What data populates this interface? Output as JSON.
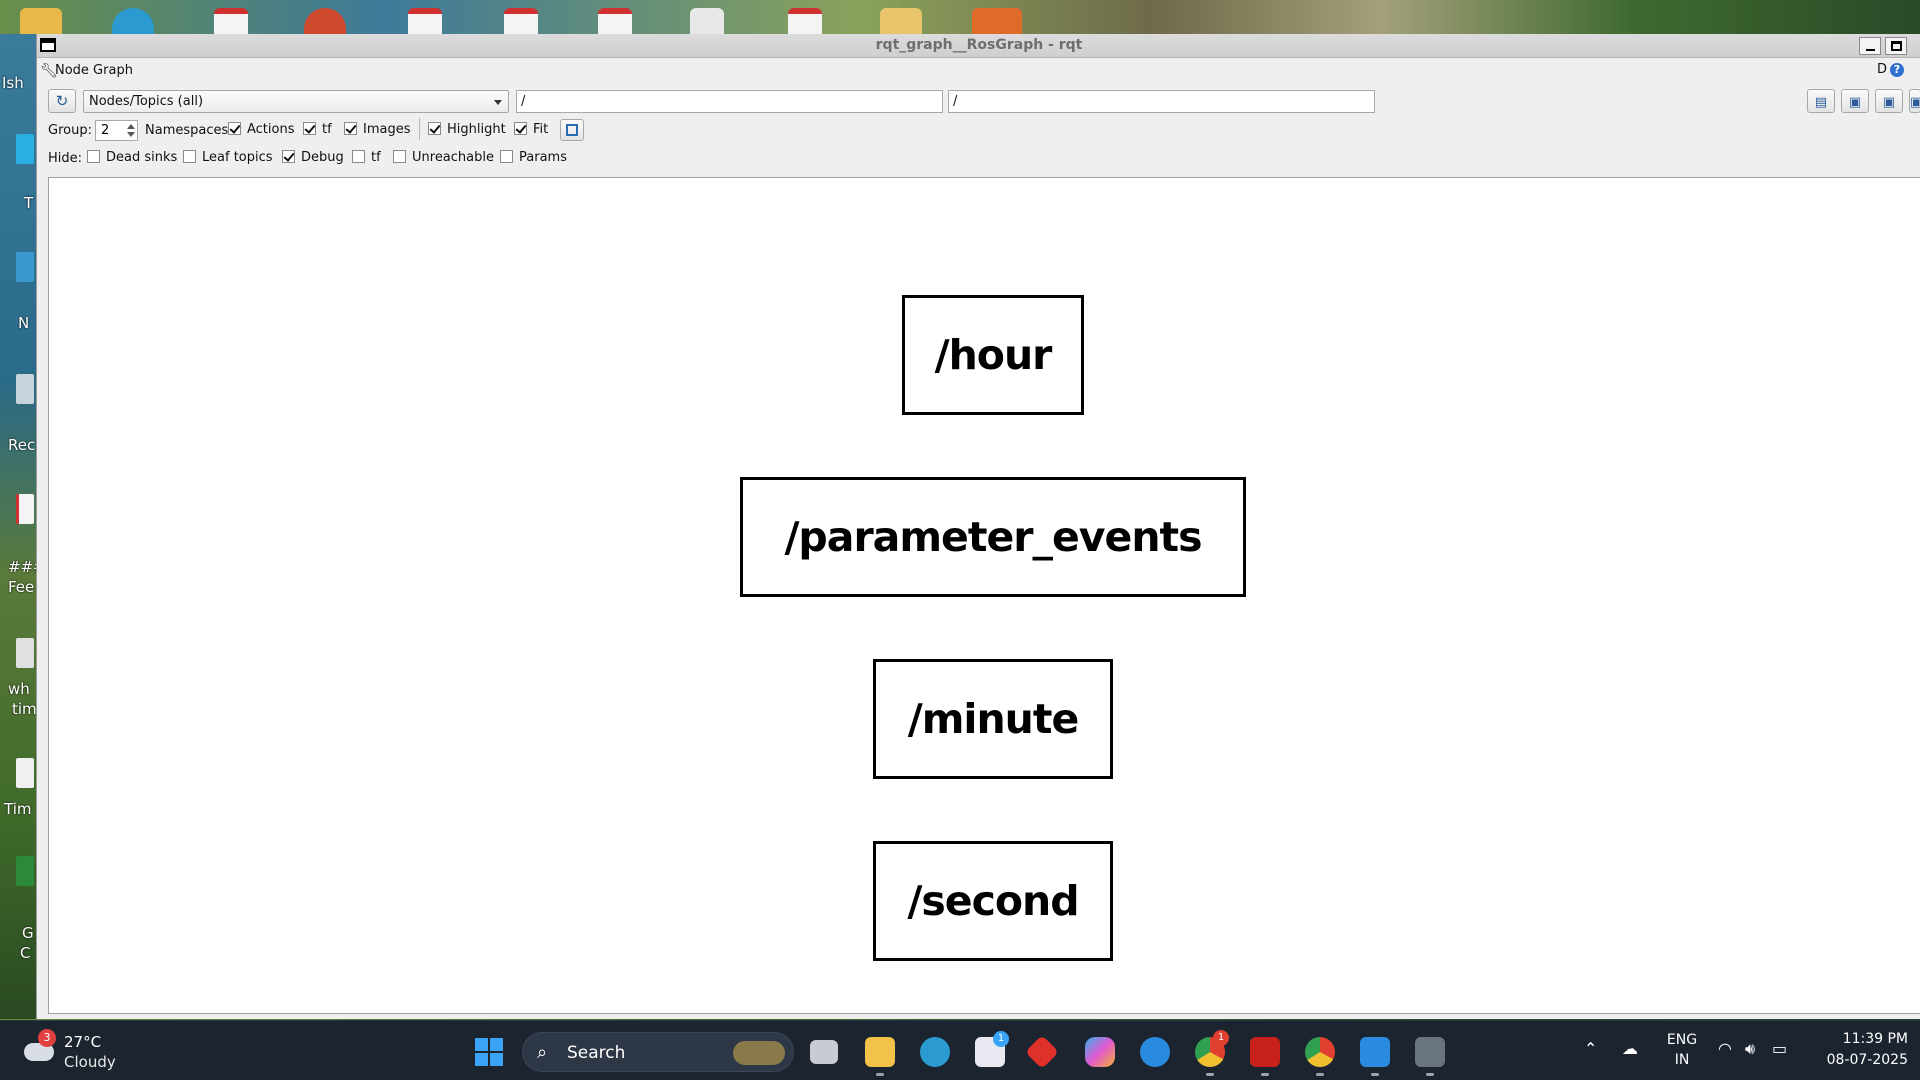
{
  "window": {
    "title": "rqt_graph__RosGraph - rqt"
  },
  "plugin": {
    "title": "Node Graph",
    "d_label": "D",
    "help_label": "?"
  },
  "toolbar": {
    "view_mode": "Nodes/Topics (all)",
    "node_filter": "/",
    "topic_filter": "/"
  },
  "options": {
    "group_label": "Group:",
    "group_value": "2",
    "namespaces_label": "Namespaces",
    "actions_label": "Actions",
    "actions_checked": true,
    "tf_label": "tf",
    "tf_checked": true,
    "images_label": "Images",
    "images_checked": true,
    "highlight_label": "Highlight",
    "highlight_checked": true,
    "fit_label": "Fit",
    "fit_checked": true
  },
  "hide": {
    "label": "Hide:",
    "items": [
      {
        "label": "Dead sinks",
        "checked": false
      },
      {
        "label": "Leaf topics",
        "checked": false
      },
      {
        "label": "Debug",
        "checked": true
      },
      {
        "label": "tf",
        "checked": false
      },
      {
        "label": "Unreachable",
        "checked": false
      },
      {
        "label": "Params",
        "checked": false
      }
    ]
  },
  "graph": {
    "nodes": [
      "/hour",
      "/parameter_events",
      "/minute",
      "/second"
    ]
  },
  "desktop": {
    "left_labels": [
      "Ish",
      "T",
      "N",
      "Rec",
      "###",
      "Fee",
      "wh",
      "tim",
      "Tim",
      "G",
      "C"
    ]
  },
  "taskbar": {
    "weather_badge": "3",
    "weather_temp": "27°C",
    "weather_desc": "Cloudy",
    "search_placeholder": "Search",
    "store_badge": "1",
    "chrome_badge": "1",
    "language_line1": "ENG",
    "language_line2": "IN",
    "time": "11:39 PM",
    "date": "08-07-2025"
  },
  "colors": {
    "taskbar": "#1c2430",
    "accent": "#3aa3f5",
    "window_bg": "#efefef",
    "canvas_bg": "#ffffff"
  }
}
